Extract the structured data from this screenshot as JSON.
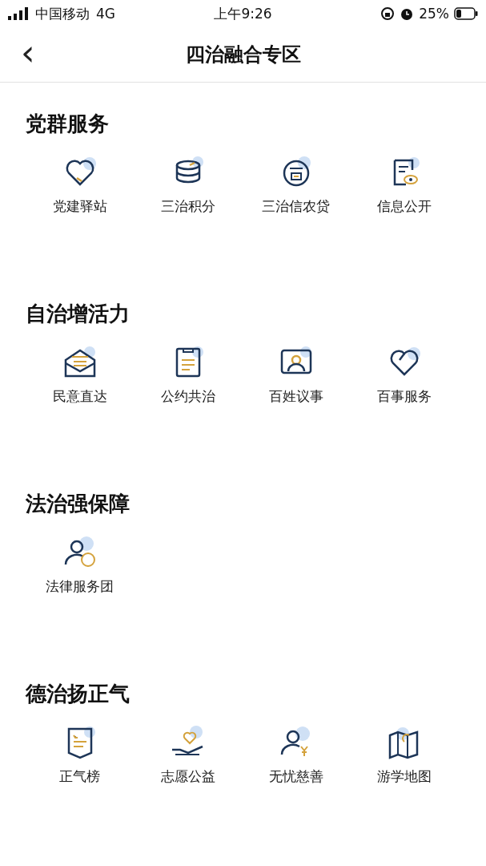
{
  "status_bar": {
    "carrier": "中国移动",
    "network": "4G",
    "time": "上午9:26",
    "battery": "25%"
  },
  "nav": {
    "back": "‹",
    "title": "四治融合专区"
  },
  "sections": [
    {
      "title": "党群服务",
      "items": [
        {
          "label": "党建驿站"
        },
        {
          "label": "三治积分"
        },
        {
          "label": "三治信农贷"
        },
        {
          "label": "信息公开"
        }
      ]
    },
    {
      "title": "自治增活力",
      "items": [
        {
          "label": "民意直达"
        },
        {
          "label": "公约共治"
        },
        {
          "label": "百姓议事"
        },
        {
          "label": "百事服务"
        }
      ]
    },
    {
      "title": "法治强保障",
      "items": [
        {
          "label": "法律服务团"
        }
      ]
    },
    {
      "title": "德治扬正气",
      "items": [
        {
          "label": "正气榜"
        },
        {
          "label": "志愿公益"
        },
        {
          "label": "无忧慈善"
        },
        {
          "label": "游学地图"
        }
      ]
    }
  ]
}
